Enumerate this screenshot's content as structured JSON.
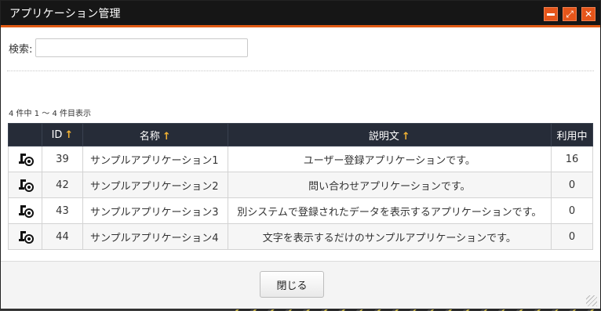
{
  "dialog": {
    "title": "アプリケーション管理",
    "buttons": {
      "minimize": "—",
      "maximize": "⤢",
      "close": "✕"
    }
  },
  "search": {
    "label": "検索:",
    "value": "",
    "placeholder": ""
  },
  "pagination": {
    "text": "4 件中 1 ～ 4 件目表示"
  },
  "table": {
    "headers": {
      "icon": "",
      "id": "ID",
      "name": "名称",
      "description": "説明文",
      "usage": "利用中"
    },
    "sort_arrow": "↑",
    "rows": [
      {
        "id": "39",
        "name": "サンプルアプリケーション1",
        "description": "ユーザー登録アプリケーションです。",
        "usage": "16"
      },
      {
        "id": "42",
        "name": "サンプルアプリケーション2",
        "description": "問い合わせアプリケーションです。",
        "usage": "0"
      },
      {
        "id": "43",
        "name": "サンプルアプリケーション3",
        "description": "別システムで登録されたデータを表示するアプリケーションです。",
        "usage": "0"
      },
      {
        "id": "44",
        "name": "サンプルアプリケーション4",
        "description": "文字を表示するだけのサンプルアプリケーションです。",
        "usage": "0"
      }
    ]
  },
  "footer": {
    "close_label": "閉じる"
  },
  "colors": {
    "accent": "#e05a14",
    "header_bg": "#262c38",
    "sort_arrow": "#f2b233",
    "link": "#1e6fa8"
  },
  "icons": {
    "row": "app-settings-icon"
  }
}
